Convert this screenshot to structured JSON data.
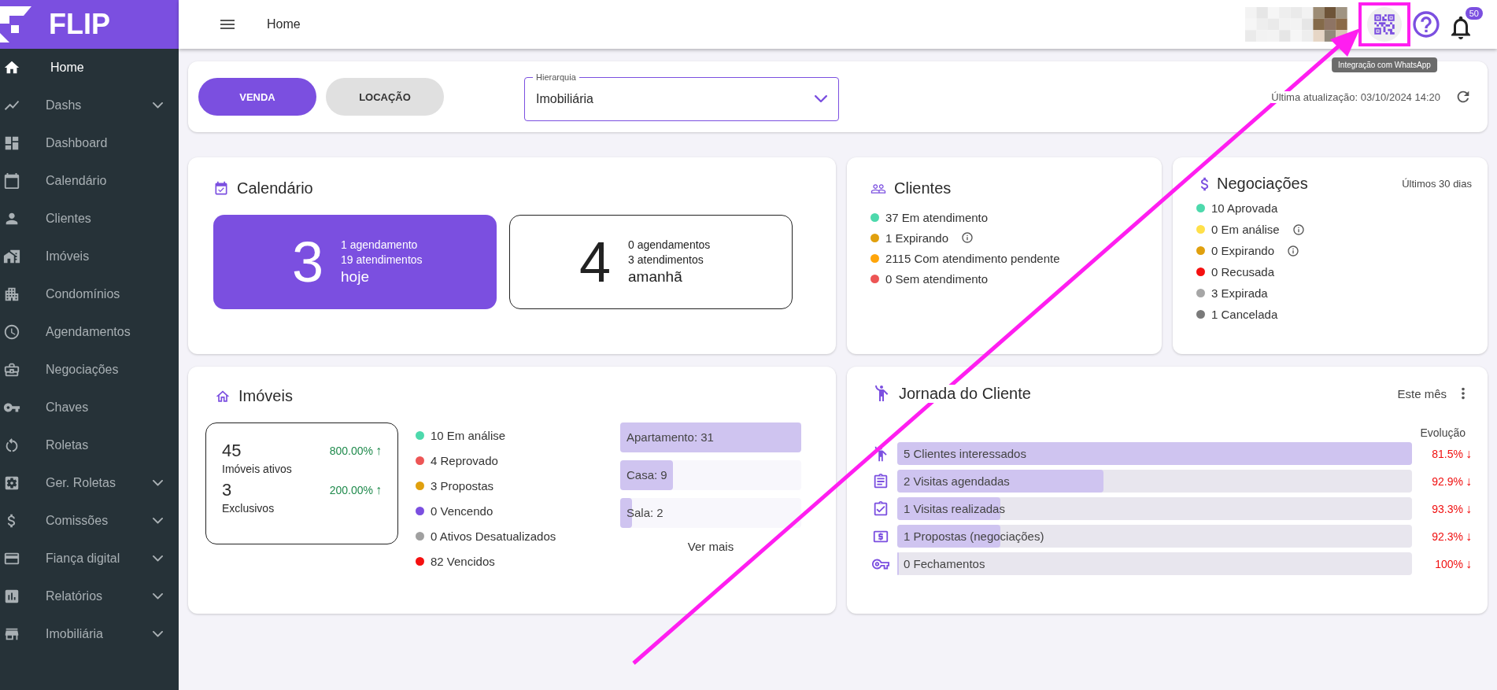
{
  "brand": {
    "name": "FLIP"
  },
  "sidebar": {
    "items": [
      {
        "label": "Home",
        "selected": true,
        "expandable": false
      },
      {
        "label": "Dashs",
        "selected": false,
        "expandable": true
      },
      {
        "label": "Dashboard",
        "selected": false,
        "expandable": false
      },
      {
        "label": "Calendário",
        "selected": false,
        "expandable": false
      },
      {
        "label": "Clientes",
        "selected": false,
        "expandable": false
      },
      {
        "label": "Imóveis",
        "selected": false,
        "expandable": false
      },
      {
        "label": "Condomínios",
        "selected": false,
        "expandable": false
      },
      {
        "label": "Agendamentos",
        "selected": false,
        "expandable": false
      },
      {
        "label": "Negociações",
        "selected": false,
        "expandable": false
      },
      {
        "label": "Chaves",
        "selected": false,
        "expandable": false
      },
      {
        "label": "Roletas",
        "selected": false,
        "expandable": false
      },
      {
        "label": "Ger. Roletas",
        "selected": false,
        "expandable": true
      },
      {
        "label": "Comissões",
        "selected": false,
        "expandable": true
      },
      {
        "label": "Fiança digital",
        "selected": false,
        "expandable": true
      },
      {
        "label": "Relatórios",
        "selected": false,
        "expandable": true
      },
      {
        "label": "Imobiliária",
        "selected": false,
        "expandable": true
      }
    ]
  },
  "header": {
    "title": "Home",
    "notifications": "50",
    "tooltip": "Integração com WhatsApp"
  },
  "filters": {
    "modes": [
      {
        "label": "VENDA",
        "selected": true
      },
      {
        "label": "LOCAÇÃO",
        "selected": false
      }
    ],
    "hierarchy": {
      "label": "Hierarquia",
      "value": "Imobiliária"
    },
    "last_update": "Última atualização: 03/10/2024 14:20"
  },
  "calendar": {
    "title": "Calendário",
    "days": [
      {
        "count": "3",
        "schedules": "1 agendamento",
        "services": "19 atendimentos",
        "day": "hoje",
        "selected": true
      },
      {
        "count": "4",
        "schedules": "0 agendamentos",
        "services": "3 atendimentos",
        "day": "amanhã",
        "selected": false
      }
    ]
  },
  "clients": {
    "title": "Clientes",
    "items": [
      {
        "label": "37 Em atendimento",
        "color": "#4dd9ac",
        "info": false
      },
      {
        "label": "1 Expirando",
        "color": "#e0a00e",
        "info": true
      },
      {
        "label": "2115 Com atendimento pendente",
        "color": "#ffa50a",
        "info": false
      },
      {
        "label": "0 Sem atendimento",
        "color": "#ed5555",
        "info": false
      }
    ]
  },
  "deals": {
    "title": "Negociações",
    "period": "Últimos 30 dias",
    "items": [
      {
        "label": "10 Aprovada",
        "color": "#4dd9ac",
        "info": false
      },
      {
        "label": "0 Em análise",
        "color": "#ffe04a",
        "info": true
      },
      {
        "label": "0 Expirando",
        "color": "#e0a00e",
        "info": true
      },
      {
        "label": "0 Recusada",
        "color": "#f51010",
        "info": false
      },
      {
        "label": "3 Expirada",
        "color": "#a6a6a6",
        "info": false
      },
      {
        "label": "1 Cancelada",
        "color": "#7a7a7a",
        "info": false
      }
    ]
  },
  "properties": {
    "title": "Imóveis",
    "stats": [
      {
        "value": "45",
        "label": "Imóveis ativos",
        "change": "800.00%",
        "arrow": "↑"
      },
      {
        "value": "3",
        "label": "Exclusivos",
        "change": "200.00%",
        "arrow": "↑"
      }
    ],
    "statuses": [
      {
        "label": "10 Em análise",
        "color": "#4dd9ac"
      },
      {
        "label": "4 Reprovado",
        "color": "#ed5555"
      },
      {
        "label": "3 Propostas",
        "color": "#e0a00e"
      },
      {
        "label": "0 Vencendo",
        "color": "#7b4fe0"
      },
      {
        "label": "0 Ativos Desatualizados",
        "color": "#a0a0a0"
      },
      {
        "label": "82 Vencidos",
        "color": "#f51010"
      }
    ],
    "types": [
      {
        "label": "Apartamento: 31",
        "level": 1
      },
      {
        "label": "Casa: 9",
        "level": 0.29
      },
      {
        "label": "Sala: 2",
        "level": 0.065
      }
    ],
    "more": "Ver mais"
  },
  "journey": {
    "title": "Jornada do Cliente",
    "period": "Este mês",
    "column": "Evolução",
    "steps": [
      {
        "label": "5 Clientes interessados",
        "level": 1,
        "change": "81.5%",
        "arrow": "↓"
      },
      {
        "label": "2 Visitas agendadas",
        "level": 0.4,
        "change": "92.9%",
        "arrow": "↓"
      },
      {
        "label": "1 Visitas realizadas",
        "level": 0.2,
        "change": "93.3%",
        "arrow": "↓"
      },
      {
        "label": "1 Propostas (negociações)",
        "level": 0.2,
        "change": "92.3%",
        "arrow": "↓"
      },
      {
        "label": "0 Fechamentos",
        "level": 0,
        "change": "100%",
        "arrow": "↓"
      }
    ]
  }
}
